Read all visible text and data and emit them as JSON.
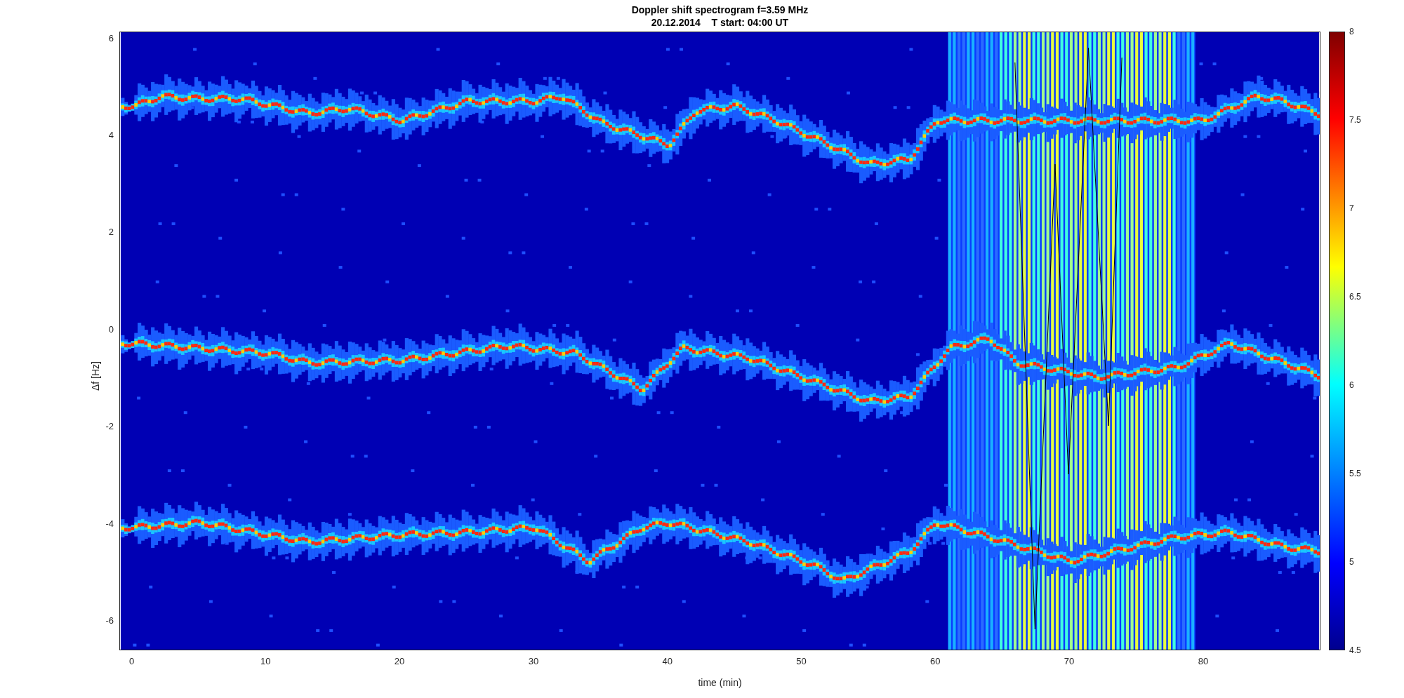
{
  "title": [
    "Doppler shift spectrogram f=3.59 MHz",
    "20.12.2014    T start: 04:00 UT"
  ],
  "y_axis": {
    "label": "Δf [Hz]",
    "ticks": [
      "6",
      "4",
      "2",
      "0",
      "-2",
      "-4",
      "-6"
    ]
  },
  "x_axis": {
    "label": "time (min)",
    "ticks": [
      "0",
      "10",
      "20",
      "30",
      "40",
      "50",
      "60",
      "70",
      "80"
    ]
  },
  "colorbar": {
    "ticks": [
      "8",
      "7.5",
      "7",
      "6.5",
      "6",
      "5.5",
      "5",
      "4.5"
    ]
  }
}
